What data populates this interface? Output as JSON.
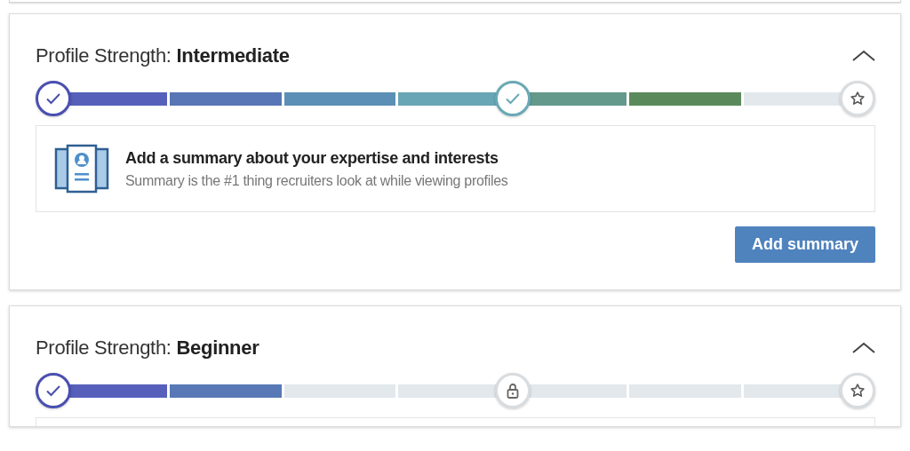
{
  "cards": [
    {
      "title": "Profile Strength: **Intermediate**",
      "expanded": true,
      "progress": [
        {
          "kind": "done",
          "color": "#4a4fb0"
        },
        {
          "kind": "segment",
          "filled": true,
          "color": "#5660bb"
        },
        {
          "kind": "segment",
          "filled": true,
          "color": "#5876b6"
        },
        {
          "kind": "segment",
          "filled": true,
          "color": "#5c8fb5"
        },
        {
          "kind": "segment",
          "filled": true,
          "color": "#68a6b6"
        },
        {
          "kind": "done",
          "color": "#6aa9b5"
        },
        {
          "kind": "segment",
          "filled": true,
          "color": "#62998a"
        },
        {
          "kind": "segment",
          "filled": true,
          "color": "#5a8a5c"
        },
        {
          "kind": "segment",
          "filled": false
        },
        {
          "kind": "goal"
        }
      ],
      "suggestion": {
        "title": "Add a summary about your expertise and interests",
        "subtitle": "Summary is the #1 thing recruiters look at while viewing profiles"
      },
      "button": "Add summary"
    },
    {
      "title": "Profile Strength: **Beginner**",
      "expanded": true,
      "progress": [
        {
          "kind": "done",
          "color": "#4a4fb0"
        },
        {
          "kind": "segment",
          "filled": true,
          "color": "#5660bb"
        },
        {
          "kind": "segment",
          "filled": true,
          "color": "#5879b6"
        },
        {
          "kind": "segment",
          "filled": false
        },
        {
          "kind": "segment",
          "filled": false
        },
        {
          "kind": "locked"
        },
        {
          "kind": "segment",
          "filled": false
        },
        {
          "kind": "segment",
          "filled": false
        },
        {
          "kind": "segment",
          "filled": false
        },
        {
          "kind": "goal"
        }
      ]
    }
  ]
}
